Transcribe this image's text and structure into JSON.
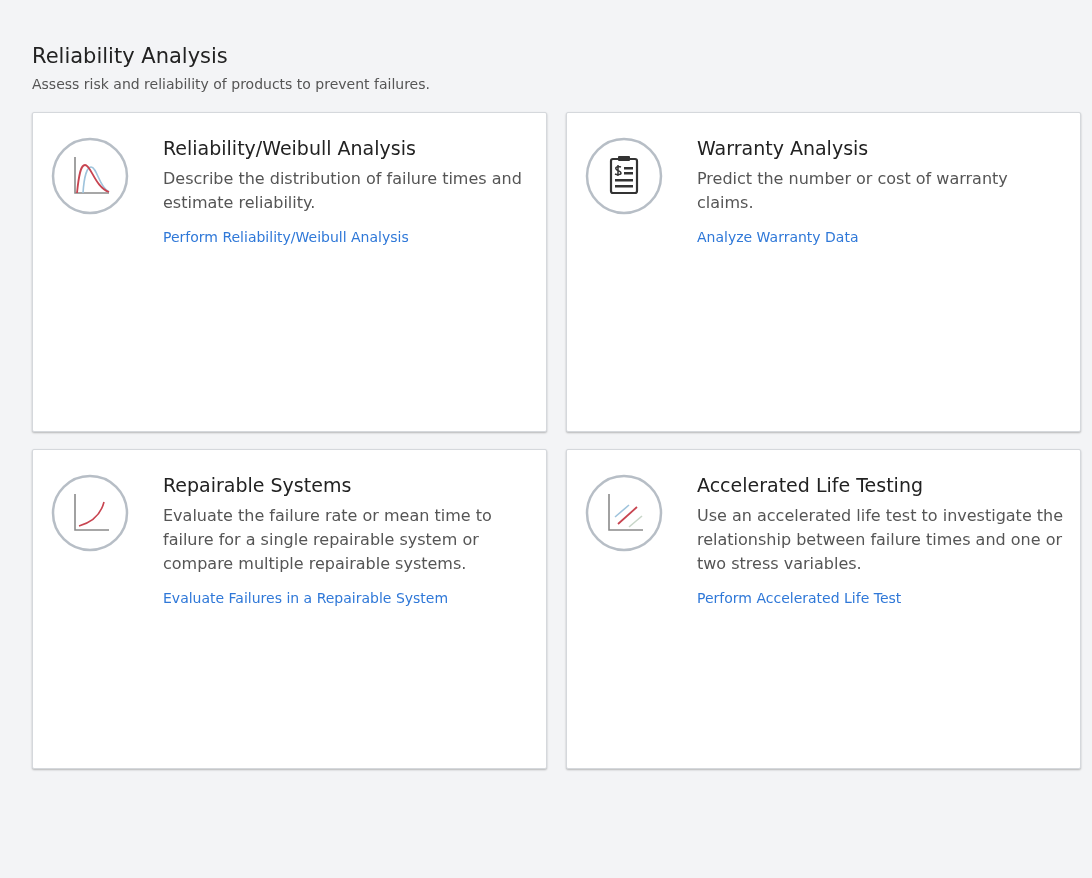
{
  "section": {
    "title": "Reliability Analysis",
    "subtitle": "Assess risk and reliability of products to prevent failures."
  },
  "cards": [
    {
      "kind": "distribution",
      "title": "Reliability/Weibull Analysis",
      "description": "Describe the distribution of failure times and estimate reliability.",
      "link": "Perform Reliability/Weibull Analysis"
    },
    {
      "kind": "clipboard",
      "title": "Warranty Analysis",
      "description": "Predict the number or cost of warranty claims.",
      "link": "Analyze Warranty Data"
    },
    {
      "kind": "curve",
      "title": "Repairable Systems",
      "description": "Evaluate the failure rate or mean time to failure for a single repairable system or compare multiple repairable systems.",
      "link": "Evaluate Failures in a Repairable System"
    },
    {
      "kind": "lines",
      "title": "Accelerated Life Testing",
      "description": "Use an accelerated life test to investigate the relationship between failure times and one or two stress variables.",
      "link": "Perform Accelerated Life Test"
    }
  ]
}
